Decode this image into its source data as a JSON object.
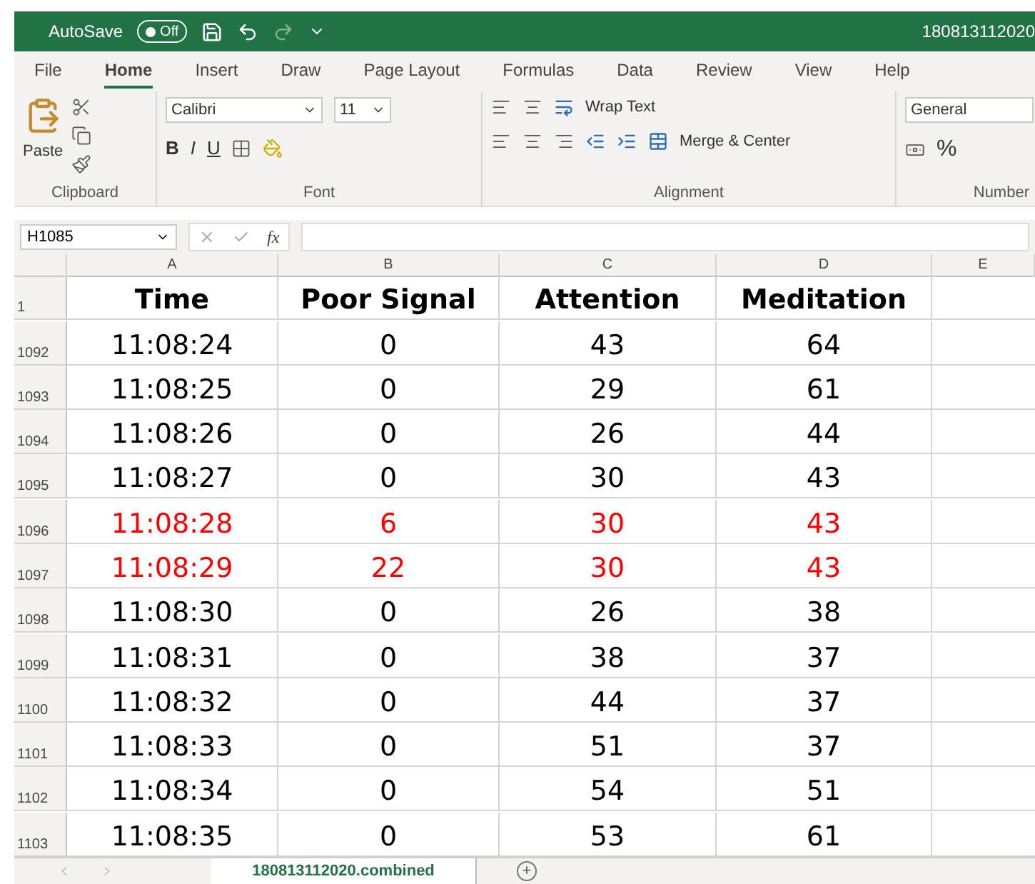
{
  "title_bar": {
    "autosave_label": "AutoSave",
    "autosave_toggle": {
      "label": "Off",
      "on": false
    },
    "title": "180813112020"
  },
  "menu_tabs": [
    {
      "label": "File",
      "selected": false
    },
    {
      "label": "Home",
      "selected": true
    },
    {
      "label": "Insert",
      "selected": false
    },
    {
      "label": "Draw",
      "selected": false
    },
    {
      "label": "Page Layout",
      "selected": false
    },
    {
      "label": "Formulas",
      "selected": false
    },
    {
      "label": "Data",
      "selected": false
    },
    {
      "label": "Review",
      "selected": false
    },
    {
      "label": "View",
      "selected": false
    },
    {
      "label": "Help",
      "selected": false
    }
  ],
  "ribbon": {
    "paste_label": "Paste",
    "font_name": "Calibri",
    "font_size": "11",
    "bold": "B",
    "italic": "I",
    "underline": "U",
    "wrap_text": "Wrap Text",
    "merge_center": "Merge & Center",
    "number_format": "General",
    "percent": "%",
    "groups": [
      "Clipboard",
      "Font",
      "Alignment",
      "Number"
    ]
  },
  "formula_bar": {
    "name_box": "H1085",
    "fx": "fx"
  },
  "columns": [
    "A",
    "B",
    "C",
    "D",
    "E"
  ],
  "header_row": {
    "number": "1",
    "cells": [
      "Time",
      "Poor Signal",
      "Attention",
      "Meditation"
    ]
  },
  "rows": [
    {
      "number": "1092",
      "color": "#000000",
      "cells": [
        "11:08:24",
        "0",
        "43",
        "64"
      ]
    },
    {
      "number": "1093",
      "color": "#000000",
      "cells": [
        "11:08:25",
        "0",
        "29",
        "61"
      ]
    },
    {
      "number": "1094",
      "color": "#000000",
      "cells": [
        "11:08:26",
        "0",
        "26",
        "44"
      ]
    },
    {
      "number": "1095",
      "color": "#000000",
      "cells": [
        "11:08:27",
        "0",
        "30",
        "43"
      ]
    },
    {
      "number": "1096",
      "color": "#ff0000",
      "cells": [
        "11:08:28",
        "6",
        "30",
        "43"
      ]
    },
    {
      "number": "1097",
      "color": "#ff0000",
      "cells": [
        "11:08:29",
        "22",
        "30",
        "43"
      ]
    },
    {
      "number": "1098",
      "color": "#000000",
      "cells": [
        "11:08:30",
        "0",
        "26",
        "38"
      ]
    },
    {
      "number": "1099",
      "color": "#000000",
      "cells": [
        "11:08:31",
        "0",
        "38",
        "37"
      ]
    },
    {
      "number": "1100",
      "color": "#000000",
      "cells": [
        "11:08:32",
        "0",
        "44",
        "37"
      ]
    },
    {
      "number": "1101",
      "color": "#000000",
      "cells": [
        "11:08:33",
        "0",
        "51",
        "37"
      ]
    },
    {
      "number": "1102",
      "color": "#000000",
      "cells": [
        "11:08:34",
        "0",
        "54",
        "51"
      ]
    },
    {
      "number": "1103",
      "color": "#000000",
      "cells": [
        "11:08:35",
        "0",
        "53",
        "61"
      ]
    }
  ],
  "sheet_tabs": [
    {
      "label": "180813112020.combined",
      "selected": true
    }
  ],
  "add_sheet": "+"
}
